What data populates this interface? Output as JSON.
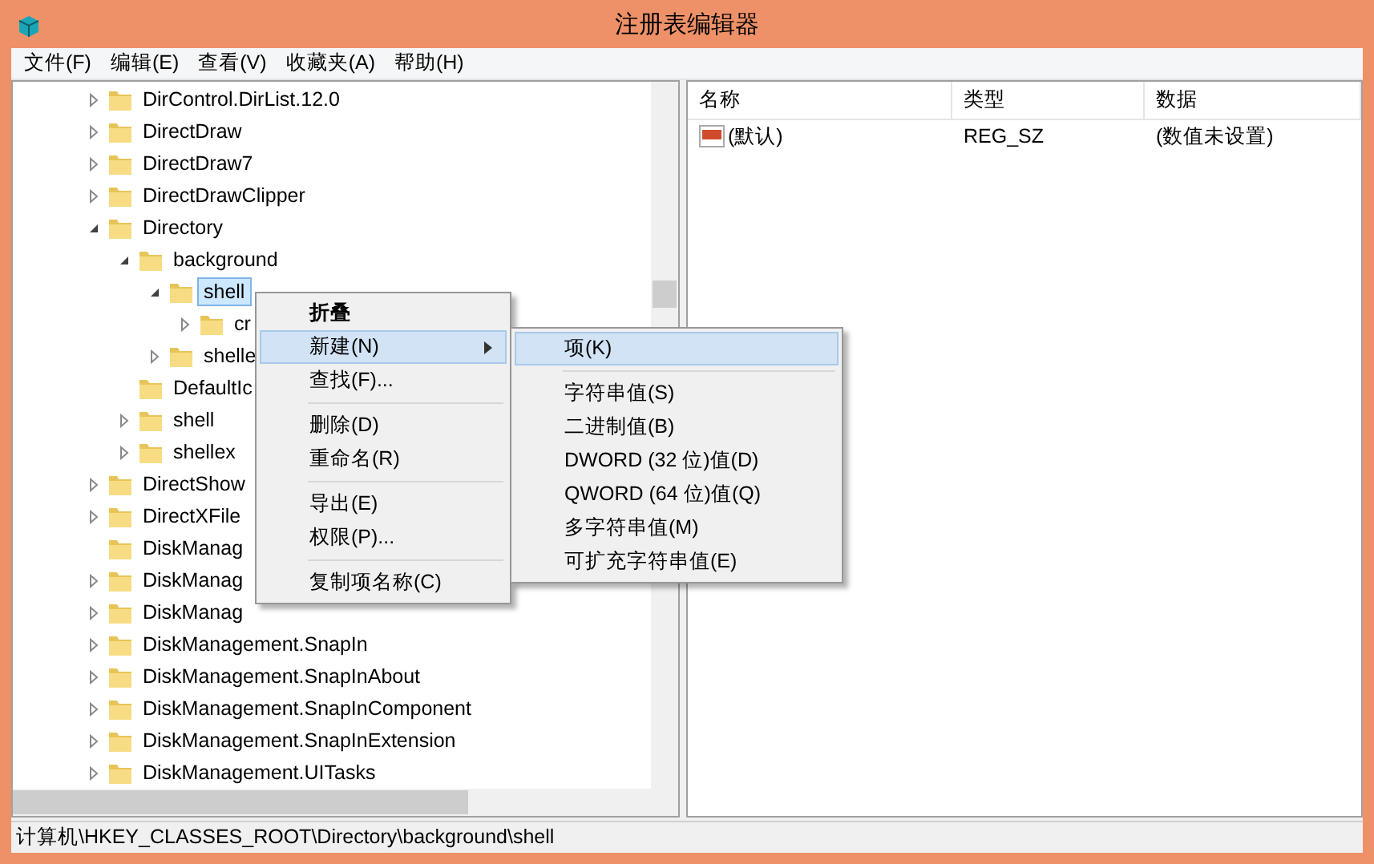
{
  "window": {
    "title": "注册表编辑器"
  },
  "menu_bar": [
    "文件(F)",
    "编辑(E)",
    "查看(V)",
    "收藏夹(A)",
    "帮助(H)"
  ],
  "tree": [
    {
      "label": "DirControl.DirList.12.0",
      "kind": "node",
      "expanded": false,
      "selected": false
    },
    {
      "label": "DirectDraw",
      "kind": "node",
      "expanded": false,
      "selected": false
    },
    {
      "label": "DirectDraw7",
      "kind": "node",
      "expanded": false,
      "selected": false
    },
    {
      "label": "DirectDrawClipper",
      "kind": "node",
      "expanded": false,
      "selected": false
    },
    {
      "label": "Directory",
      "kind": "node",
      "expanded": true,
      "selected": false,
      "children": [
        {
          "label": "background",
          "kind": "node",
          "expanded": true,
          "selected": false,
          "children": [
            {
              "label": "shell",
              "kind": "node",
              "expanded": true,
              "selected": true,
              "children": [
                {
                  "label": "cr",
                  "kind": "node",
                  "expanded": false,
                  "selected": false
                }
              ]
            },
            {
              "label": "shelle",
              "kind": "node",
              "expanded": false,
              "selected": false
            }
          ]
        },
        {
          "label": "DefaultIc",
          "kind": "leaf",
          "selected": false
        },
        {
          "label": "shell",
          "kind": "node",
          "expanded": false,
          "selected": false
        },
        {
          "label": "shellex",
          "kind": "node",
          "expanded": false,
          "selected": false
        }
      ]
    },
    {
      "label": "DirectShow",
      "kind": "node",
      "expanded": false,
      "selected": false
    },
    {
      "label": "DirectXFile",
      "kind": "node",
      "expanded": false,
      "selected": false
    },
    {
      "label": "DiskManag",
      "kind": "leaf",
      "selected": false
    },
    {
      "label": "DiskManag",
      "kind": "node",
      "expanded": false,
      "selected": false
    },
    {
      "label": "DiskManag",
      "kind": "node",
      "expanded": false,
      "selected": false
    },
    {
      "label": "DiskManagement.SnapIn",
      "kind": "node",
      "expanded": false,
      "selected": false
    },
    {
      "label": "DiskManagement.SnapInAbout",
      "kind": "node",
      "expanded": false,
      "selected": false
    },
    {
      "label": "DiskManagement.SnapInComponent",
      "kind": "node",
      "expanded": false,
      "selected": false
    },
    {
      "label": "DiskManagement.SnapInExtension",
      "kind": "node",
      "expanded": false,
      "selected": false
    },
    {
      "label": "DiskManagement.UITasks",
      "kind": "node",
      "expanded": false,
      "selected": false
    }
  ],
  "values_table": {
    "columns": [
      "名称",
      "类型",
      "数据"
    ],
    "rows": [
      {
        "name": "(默认)",
        "type": "REG_SZ",
        "data": "(数值未设置)"
      }
    ]
  },
  "context_menu": {
    "items": [
      {
        "kind": "item",
        "label": "折叠",
        "bold": true,
        "selected": false,
        "submenu": false
      },
      {
        "kind": "item",
        "label": "新建(N)",
        "bold": false,
        "selected": true,
        "submenu": true
      },
      {
        "kind": "item",
        "label": "查找(F)...",
        "bold": false,
        "selected": false,
        "submenu": false
      },
      {
        "kind": "separator"
      },
      {
        "kind": "item",
        "label": "删除(D)",
        "bold": false,
        "selected": false,
        "submenu": false
      },
      {
        "kind": "item",
        "label": "重命名(R)",
        "bold": false,
        "selected": false,
        "submenu": false
      },
      {
        "kind": "separator"
      },
      {
        "kind": "item",
        "label": "导出(E)",
        "bold": false,
        "selected": false,
        "submenu": false
      },
      {
        "kind": "item",
        "label": "权限(P)...",
        "bold": false,
        "selected": false,
        "submenu": false
      },
      {
        "kind": "separator"
      },
      {
        "kind": "item",
        "label": "复制项名称(C)",
        "bold": false,
        "selected": false,
        "submenu": false
      }
    ]
  },
  "submenu": {
    "items": [
      {
        "kind": "item",
        "label": "项(K)",
        "selected": true
      },
      {
        "kind": "separator"
      },
      {
        "kind": "item",
        "label": "字符串值(S)",
        "selected": false
      },
      {
        "kind": "item",
        "label": "二进制值(B)",
        "selected": false
      },
      {
        "kind": "item",
        "label": "DWORD (32 位)值(D)",
        "selected": false
      },
      {
        "kind": "item",
        "label": "QWORD (64 位)值(Q)",
        "selected": false
      },
      {
        "kind": "item",
        "label": "多字符串值(M)",
        "selected": false
      },
      {
        "kind": "item",
        "label": "可扩充字符串值(E)",
        "selected": false
      }
    ]
  },
  "status_bar": "计算机\\HKEY_CLASSES_ROOT\\Directory\\background\\shell"
}
